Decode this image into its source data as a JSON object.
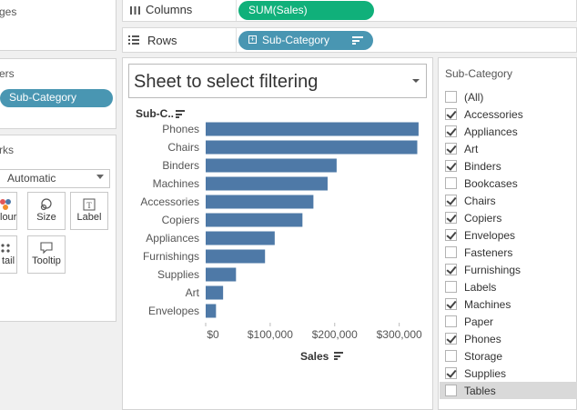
{
  "left": {
    "pages_title": "ges",
    "filters_title": "ers",
    "filter_pill": "Sub-Category",
    "marks_title": "rks",
    "mark_type": "Automatic",
    "mark_buttons": [
      "lour",
      "Size",
      "Label",
      "tail",
      "Tooltip"
    ]
  },
  "shelves": {
    "columns_label": "Columns",
    "columns_pill": "SUM(Sales)",
    "rows_label": "Rows",
    "rows_pill": "Sub-Category"
  },
  "sheet": {
    "selector_text": "Sheet to select filtering",
    "row_header": "Sub-C..",
    "x_axis_title": "Sales"
  },
  "chart_data": {
    "type": "bar",
    "orientation": "horizontal",
    "categories": [
      "Phones",
      "Chairs",
      "Binders",
      "Machines",
      "Accessories",
      "Copiers",
      "Appliances",
      "Furnishings",
      "Supplies",
      "Art",
      "Envelopes"
    ],
    "values": [
      330000,
      328000,
      203000,
      189000,
      167000,
      150000,
      107000,
      92000,
      47000,
      27000,
      16000
    ],
    "xlabel": "Sales",
    "xlim": [
      0,
      340000
    ],
    "x_ticks": [
      "$0",
      "$100,000",
      "$200,000",
      "$300,000"
    ],
    "bar_color": "#4e79a7"
  },
  "filter_panel": {
    "title": "Sub-Category",
    "items": [
      {
        "label": "(All)",
        "checked": false
      },
      {
        "label": "Accessories",
        "checked": true
      },
      {
        "label": "Appliances",
        "checked": true
      },
      {
        "label": "Art",
        "checked": true
      },
      {
        "label": "Binders",
        "checked": true
      },
      {
        "label": "Bookcases",
        "checked": false
      },
      {
        "label": "Chairs",
        "checked": true
      },
      {
        "label": "Copiers",
        "checked": true
      },
      {
        "label": "Envelopes",
        "checked": true
      },
      {
        "label": "Fasteners",
        "checked": false
      },
      {
        "label": "Furnishings",
        "checked": true
      },
      {
        "label": "Labels",
        "checked": false
      },
      {
        "label": "Machines",
        "checked": true
      },
      {
        "label": "Paper",
        "checked": false
      },
      {
        "label": "Phones",
        "checked": true
      },
      {
        "label": "Storage",
        "checked": false
      },
      {
        "label": "Supplies",
        "checked": true
      },
      {
        "label": "Tables",
        "checked": false,
        "highlighted": true
      }
    ]
  }
}
